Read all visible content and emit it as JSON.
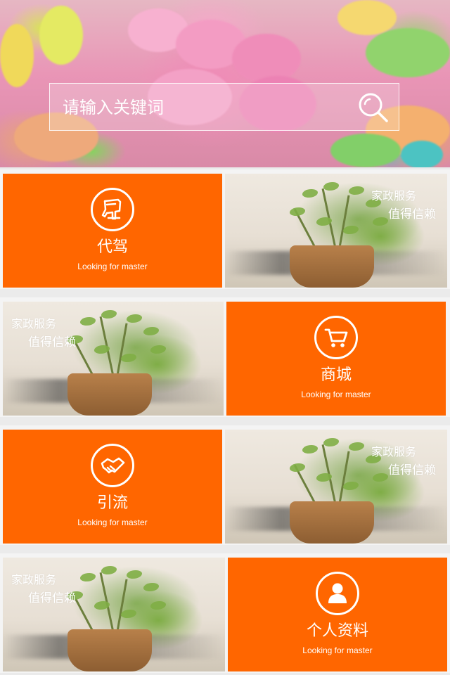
{
  "search": {
    "placeholder": "请输入关键词",
    "icon": "search-icon"
  },
  "colors": {
    "accent": "#ff6600",
    "text_on_accent": "#ffffff"
  },
  "tiles": [
    {
      "title": "代驾",
      "subtitle": "Looking for master",
      "icon": "driver-seat-icon"
    },
    {
      "title": "商城",
      "subtitle": "Looking for master",
      "icon": "cart-icon"
    },
    {
      "title": "引流",
      "subtitle": "Looking for master",
      "icon": "handshake-icon"
    },
    {
      "title": "个人资料",
      "subtitle": "Looking for master",
      "icon": "user-icon"
    }
  ],
  "promo": {
    "line1": "家政服务",
    "line2": "值得信赖"
  }
}
